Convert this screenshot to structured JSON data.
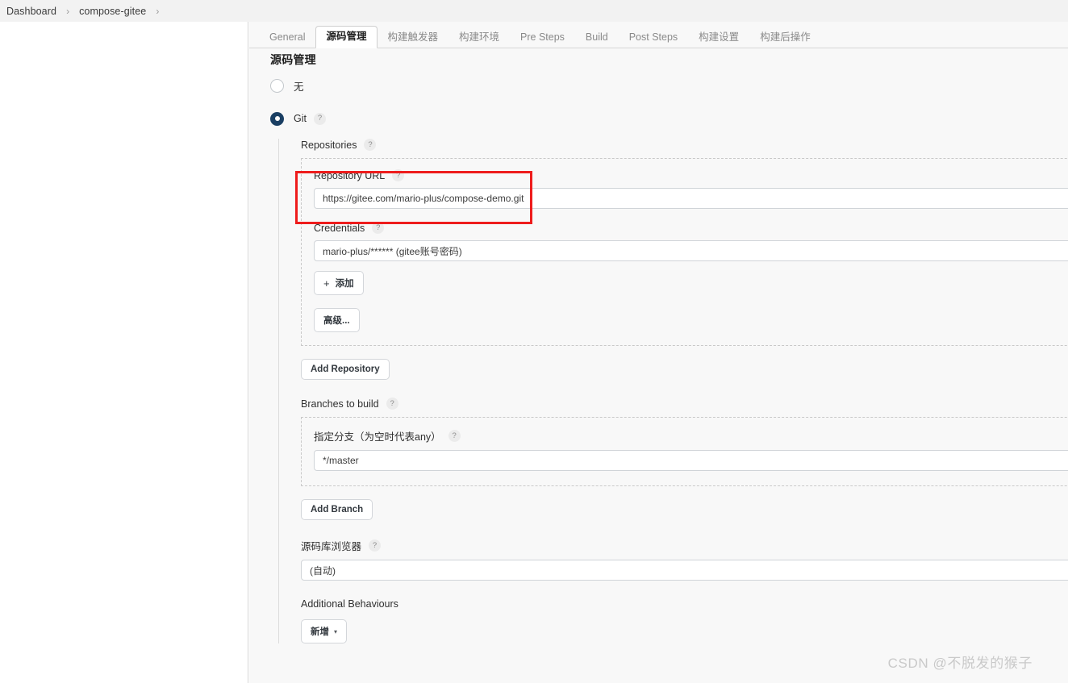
{
  "breadcrumb": {
    "items": [
      "Dashboard",
      "compose-gitee"
    ],
    "separator": "›"
  },
  "tabs": [
    {
      "label": "General",
      "active": false
    },
    {
      "label": "源码管理",
      "active": true
    },
    {
      "label": "构建触发器",
      "active": false
    },
    {
      "label": "构建环境",
      "active": false
    },
    {
      "label": "Pre Steps",
      "active": false
    },
    {
      "label": "Build",
      "active": false
    },
    {
      "label": "Post Steps",
      "active": false
    },
    {
      "label": "构建设置",
      "active": false
    },
    {
      "label": "构建后操作",
      "active": false
    }
  ],
  "section": {
    "title": "源码管理"
  },
  "scm": {
    "options": [
      {
        "label": "无",
        "selected": false,
        "has_help": false
      },
      {
        "label": "Git",
        "selected": true,
        "has_help": true
      }
    ],
    "repositories_label": "Repositories",
    "repository": {
      "url_label": "Repository URL",
      "url_value": "https://gitee.com/mario-plus/compose-demo.git",
      "credentials_label": "Credentials",
      "credentials_value": "mario-plus/****** (gitee账号密码)",
      "add_credentials_label": "添加",
      "add_credentials_plus": "+",
      "advanced_label": "高级..."
    },
    "add_repository_label": "Add Repository",
    "branches": {
      "section_label": "Branches to build",
      "specifier_label": "指定分支（为空时代表any）",
      "specifier_value": "*/master",
      "add_branch_label": "Add Branch"
    },
    "browser": {
      "label": "源码库浏览器",
      "value": "(自动)"
    },
    "additional_behaviours": {
      "label": "Additional Behaviours",
      "add_label": "新增",
      "caret": "▾"
    },
    "help_glyph": "?"
  },
  "annotation": {
    "highlight_color": "#ee1c1c"
  },
  "watermark": {
    "text": "CSDN @不脱发的猴子"
  }
}
